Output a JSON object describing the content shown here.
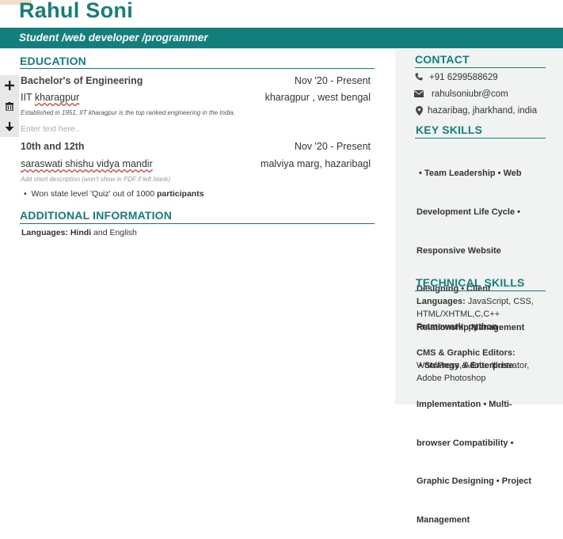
{
  "header": {
    "name": "Rahul Soni",
    "tagline": "Student /web developer /programmer"
  },
  "toolbar": {
    "add_icon": "plus-icon",
    "delete_icon": "trash-icon",
    "move_down_icon": "arrow-down-icon"
  },
  "education": {
    "heading": "EDUCATION",
    "entries": [
      {
        "degree": "Bachelor's of Engineering",
        "dates": "Nov '20  -  Present",
        "institution": "IIT kharagpur",
        "location": "kharagpur , west bengal",
        "description": "Established in 1951, IIT kharagpur is the top ranked engineering in the India.",
        "extra_placeholder": "Enter text here.."
      },
      {
        "degree": "10th and 12th",
        "dates": "Nov '20  -  Present",
        "institution": "saraswati shishu vidya mandir",
        "location": "malviya marg, hazaribagl",
        "description_placeholder": "Add short description (won't show in PDF if left blank)",
        "bullet_prefix": "Won state level 'Quiz' out of 1000 ",
        "bullet_bold": "participants"
      }
    ]
  },
  "additional": {
    "heading": "ADDITIONAL INFORMATION",
    "languages_label": "Languages: ",
    "languages_bold": "Hindi",
    "languages_rest": " and English"
  },
  "contact": {
    "heading": "CONTACT",
    "phone": "+91 6299588629",
    "email": "rahulsoniubr@com",
    "address": "hazaribag, jharkhand, india"
  },
  "key_skills": {
    "heading": "KEY SKILLS",
    "lines": [
      " • Team Leadership • Web",
      "Development Life Cycle •",
      "Responsive Website",
      "Designing • Client",
      "Relationship Management",
      " • Strategy & Enterprise",
      "Implementation • Multi-",
      "browser Compatibility •",
      "Graphic Designing • Project",
      "Management"
    ]
  },
  "technical_skills": {
    "heading": "TECHNICAL SKILLS",
    "languages_label": "Languages: ",
    "languages_line1": "JavaScript, CSS,",
    "languages_line2": "HTML/XHTML,C,C++",
    "framework_label": "Framework: python",
    "cms_label": "CMS & Graphic Editors:",
    "cms_line1": "WordPress, Adobe Illustrator,",
    "cms_line2": "Adobe Photoshop"
  }
}
